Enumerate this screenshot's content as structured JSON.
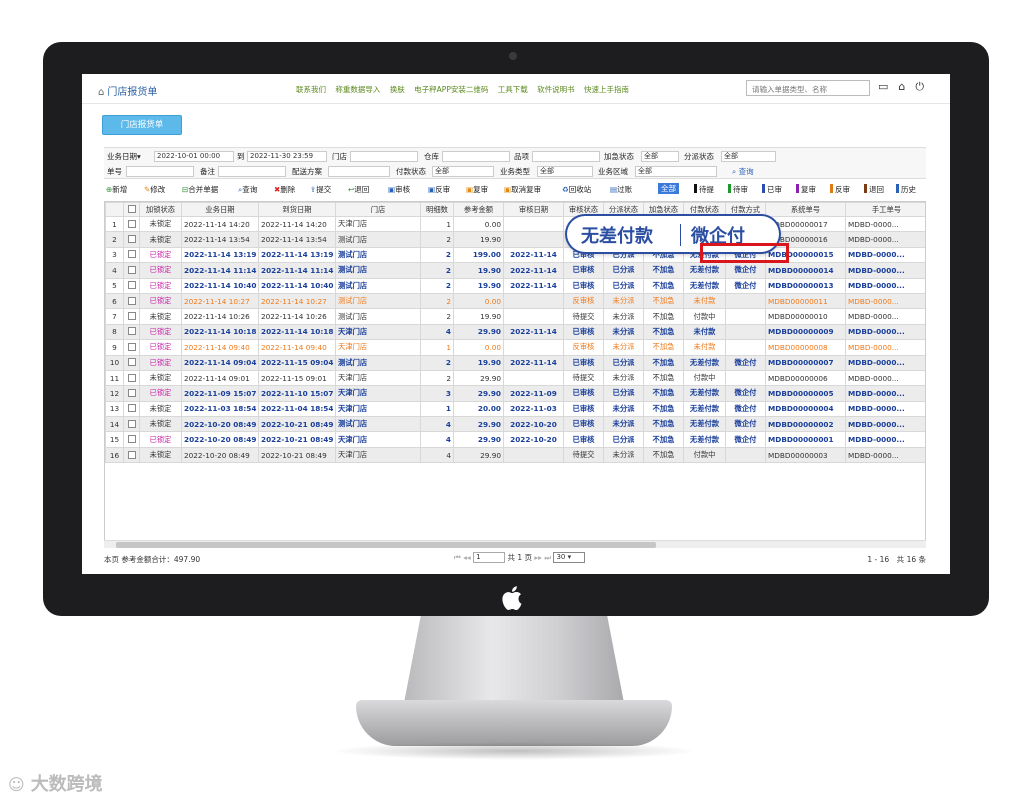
{
  "app": {
    "title": "门店报货单",
    "links": [
      "联系我们",
      "称重数据导入",
      "换肤",
      "电子秤APP安装二维码",
      "工具下载",
      "软件说明书",
      "快速上手指南"
    ],
    "search_placeholder": "请输入单据类型、名称",
    "tab_button": "门店报货单"
  },
  "filters": {
    "row1": {
      "date_type": "业务日期▾",
      "date_from": "2022-10-01 00:00",
      "to_label": "到",
      "date_to": "2022-11-30 23:59",
      "store_label": "门店",
      "warehouse_label": "仓库",
      "item_label": "品项",
      "urgent_label": "加急状态",
      "urgent_value": "全部",
      "dispatch_label": "分派状态",
      "dispatch_value": "全部"
    },
    "row2": {
      "no_label": "单号",
      "remark_label": "备注",
      "delivery_label": "配送方案",
      "pay_label": "付款状态",
      "pay_value": "全部",
      "biz_type_label": "业务类型",
      "biz_type_value": "全部",
      "region_label": "业务区域",
      "region_value": "全部",
      "query": "查询"
    }
  },
  "toolbar": {
    "new": "新增",
    "edit": "修改",
    "merge": "合并单据",
    "query": "查询",
    "delete": "删除",
    "submit": "提交",
    "return": "退回",
    "audit": "审核",
    "unaudit": "反审",
    "recheck": "复审",
    "cancel_recheck": "取消复审",
    "recycle": "回收站",
    "filter": "过账"
  },
  "legend": [
    {
      "label": "全部",
      "color": "#3b7ad9"
    },
    {
      "label": "待提",
      "color": "#111111"
    },
    {
      "label": "待审",
      "color": "#1d9b2a"
    },
    {
      "label": "已审",
      "color": "#2a4fb0"
    },
    {
      "label": "复审",
      "color": "#8a1fb0"
    },
    {
      "label": "反审",
      "color": "#e07b12"
    },
    {
      "label": "退回",
      "color": "#7a3a14"
    },
    {
      "label": "历史",
      "color": "#2a62b8"
    }
  ],
  "columns": [
    "",
    "",
    "加锁状态",
    "业务日期",
    "到货日期",
    "门店",
    "明细数",
    "参考金额",
    "审核日期",
    "审核状态",
    "分派状态",
    "加急状态",
    "付款状态",
    "付款方式",
    "系统单号",
    "手工单号"
  ],
  "rows": [
    {
      "n": "1",
      "lock": "未锁定",
      "biz": "2022-11-14 14:20",
      "arr": "2022-11-14 14:20",
      "store": "天津门店",
      "cnt": "1",
      "amt": "0.00",
      "adate": "",
      "astat": "",
      "dstat": "",
      "ustat": "",
      "pstat": "",
      "pway": "",
      "sys": "MDBD00000017",
      "man": "MDBD-0000...",
      "t": "n"
    },
    {
      "n": "2",
      "lock": "未锁定",
      "biz": "2022-11-14 13:54",
      "arr": "2022-11-14 13:54",
      "store": "测试门店",
      "cnt": "2",
      "amt": "19.90",
      "adate": "",
      "astat": "",
      "dstat": "",
      "ustat": "",
      "pstat": "",
      "pway": "",
      "sys": "MDBD00000016",
      "man": "MDBD-0000...",
      "t": "n"
    },
    {
      "n": "3",
      "lock": "已锁定",
      "biz": "2022-11-14 13:19",
      "arr": "2022-11-14 13:19",
      "store": "测试门店",
      "cnt": "2",
      "amt": "199.00",
      "adate": "2022-11-14",
      "astat": "已审核",
      "dstat": "已分派",
      "ustat": "不加急",
      "pstat": "无差付款",
      "pway": "微企付",
      "sys": "MDBD00000015",
      "man": "MDBD-0000...",
      "t": "l"
    },
    {
      "n": "4",
      "lock": "已锁定",
      "biz": "2022-11-14 11:14",
      "arr": "2022-11-14 11:14",
      "store": "测试门店",
      "cnt": "2",
      "amt": "19.90",
      "adate": "2022-11-14",
      "astat": "已审核",
      "dstat": "已分派",
      "ustat": "不加急",
      "pstat": "无差付款",
      "pway": "微企付",
      "sys": "MDBD00000014",
      "man": "MDBD-0000...",
      "t": "l"
    },
    {
      "n": "5",
      "lock": "已锁定",
      "biz": "2022-11-14 10:40",
      "arr": "2022-11-14 10:40",
      "store": "测试门店",
      "cnt": "2",
      "amt": "19.90",
      "adate": "2022-11-14",
      "astat": "已审核",
      "dstat": "已分派",
      "ustat": "不加急",
      "pstat": "无差付款",
      "pway": "微企付",
      "sys": "MDBD00000013",
      "man": "MDBD-0000...",
      "t": "l"
    },
    {
      "n": "6",
      "lock": "已锁定",
      "biz": "2022-11-14 10:27",
      "arr": "2022-11-14 10:27",
      "store": "测试门店",
      "cnt": "2",
      "amt": "0.00",
      "adate": "",
      "astat": "反审核",
      "dstat": "未分派",
      "ustat": "不加急",
      "pstat": "未付款",
      "pway": "",
      "sys": "MDBD00000011",
      "man": "MDBD-0000...",
      "t": "r"
    },
    {
      "n": "7",
      "lock": "未锁定",
      "biz": "2022-11-14 10:26",
      "arr": "2022-11-14 10:26",
      "store": "测试门店",
      "cnt": "2",
      "amt": "19.90",
      "adate": "",
      "astat": "待提交",
      "dstat": "未分派",
      "ustat": "不加急",
      "pstat": "付款中",
      "pway": "",
      "sys": "MDBD00000010",
      "man": "MDBD-0000...",
      "t": "n"
    },
    {
      "n": "8",
      "lock": "已锁定",
      "biz": "2022-11-14 10:18",
      "arr": "2022-11-14 10:18",
      "store": "天津门店",
      "cnt": "4",
      "amt": "29.90",
      "adate": "2022-11-14",
      "astat": "已审核",
      "dstat": "未分派",
      "ustat": "不加急",
      "pstat": "未付款",
      "pway": "",
      "sys": "MDBD00000009",
      "man": "MDBD-0000...",
      "t": "l"
    },
    {
      "n": "9",
      "lock": "已锁定",
      "biz": "2022-11-14 09:40",
      "arr": "2022-11-14 09:40",
      "store": "天津门店",
      "cnt": "1",
      "amt": "0.00",
      "adate": "",
      "astat": "反审核",
      "dstat": "未分派",
      "ustat": "不加急",
      "pstat": "未付款",
      "pway": "",
      "sys": "MDBD00000008",
      "man": "MDBD-0000...",
      "t": "r"
    },
    {
      "n": "10",
      "lock": "已锁定",
      "biz": "2022-11-14 09:04",
      "arr": "2022-11-15 09:04",
      "store": "测试门店",
      "cnt": "2",
      "amt": "19.90",
      "adate": "2022-11-14",
      "astat": "已审核",
      "dstat": "已分派",
      "ustat": "不加急",
      "pstat": "无差付款",
      "pway": "微企付",
      "sys": "MDBD00000007",
      "man": "MDBD-0000...",
      "t": "l"
    },
    {
      "n": "11",
      "lock": "未锁定",
      "biz": "2022-11-14 09:01",
      "arr": "2022-11-15 09:01",
      "store": "天津门店",
      "cnt": "2",
      "amt": "29.90",
      "adate": "",
      "astat": "待提交",
      "dstat": "未分派",
      "ustat": "不加急",
      "pstat": "付款中",
      "pway": "",
      "sys": "MDBD00000006",
      "man": "MDBD-0000...",
      "t": "n"
    },
    {
      "n": "12",
      "lock": "已锁定",
      "biz": "2022-11-09 15:07",
      "arr": "2022-11-10 15:07",
      "store": "天津门店",
      "cnt": "3",
      "amt": "29.90",
      "adate": "2022-11-09",
      "astat": "已审核",
      "dstat": "已分派",
      "ustat": "不加急",
      "pstat": "无差付款",
      "pway": "微企付",
      "sys": "MDBD00000005",
      "man": "MDBD-0000...",
      "t": "l"
    },
    {
      "n": "13",
      "lock": "未锁定",
      "biz": "2022-11-03 18:54",
      "arr": "2022-11-04 18:54",
      "store": "天津门店",
      "cnt": "1",
      "amt": "20.00",
      "adate": "2022-11-03",
      "astat": "已审核",
      "dstat": "未分派",
      "ustat": "不加急",
      "pstat": "无差付款",
      "pway": "微企付",
      "sys": "MDBD00000004",
      "man": "MDBD-0000...",
      "t": "l2"
    },
    {
      "n": "14",
      "lock": "未锁定",
      "biz": "2022-10-20 08:49",
      "arr": "2022-10-21 08:49",
      "store": "测试门店",
      "cnt": "4",
      "amt": "29.90",
      "adate": "2022-10-20",
      "astat": "已审核",
      "dstat": "未分派",
      "ustat": "不加急",
      "pstat": "无差付款",
      "pway": "微企付",
      "sys": "MDBD00000002",
      "man": "MDBD-0000...",
      "t": "l2"
    },
    {
      "n": "15",
      "lock": "已锁定",
      "biz": "2022-10-20 08:49",
      "arr": "2022-10-21 08:49",
      "store": "天津门店",
      "cnt": "4",
      "amt": "29.90",
      "adate": "2022-10-20",
      "astat": "已审核",
      "dstat": "已分派",
      "ustat": "不加急",
      "pstat": "无差付款",
      "pway": "微企付",
      "sys": "MDBD00000001",
      "man": "MDBD-0000...",
      "t": "l"
    },
    {
      "n": "16",
      "lock": "未锁定",
      "biz": "2022-10-20 08:49",
      "arr": "2022-10-21 08:49",
      "store": "天津门店",
      "cnt": "4",
      "amt": "29.90",
      "adate": "",
      "astat": "待提交",
      "dstat": "未分派",
      "ustat": "不加急",
      "pstat": "付款中",
      "pway": "",
      "sys": "MDBD00000003",
      "man": "MDBD-0000...",
      "t": "n"
    }
  ],
  "footer": {
    "sum": "本页 参考金额合计：497.90",
    "page_value": "1",
    "page_total": "共 1 页",
    "page_size": "30",
    "range": "1 - 16　共 16 条"
  },
  "callout": {
    "text1": "无差付款",
    "text2": "微企付"
  },
  "watermark": "大数跨境"
}
